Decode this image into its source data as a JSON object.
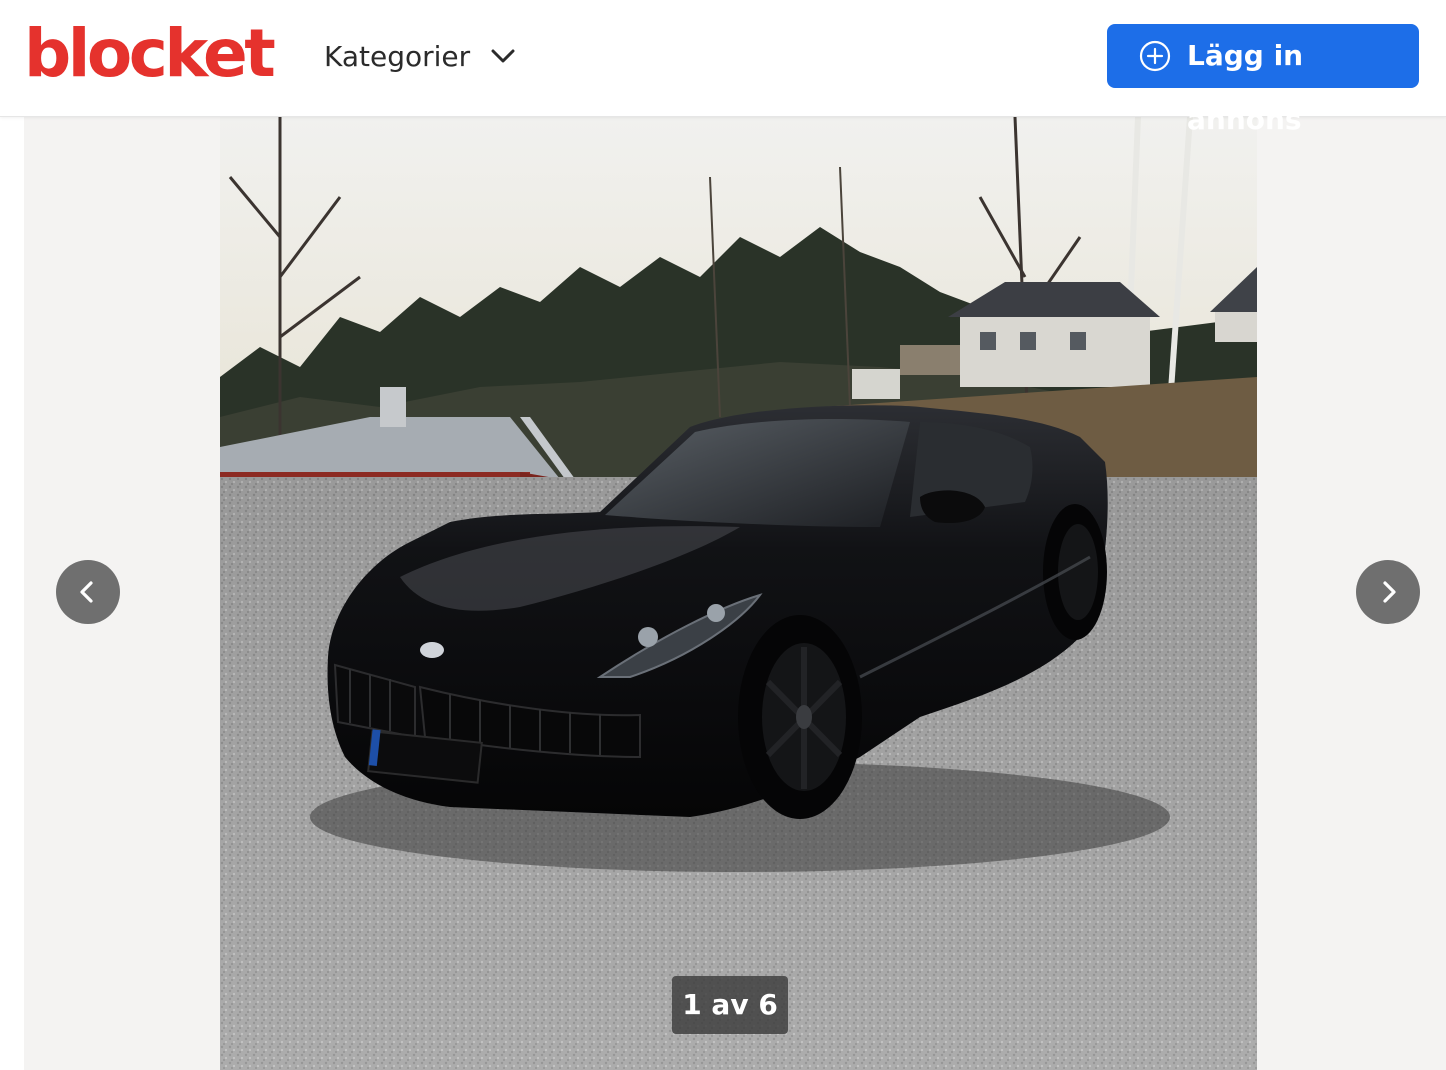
{
  "header": {
    "logo_text": "blocket",
    "categories_label": "Kategorier",
    "cta_label": "Lägg in annons"
  },
  "gallery": {
    "counter_text": "1 av 6",
    "prev_icon": "chevron-left-icon",
    "next_icon": "chevron-right-icon"
  },
  "colors": {
    "brand_red": "#e5322d",
    "cta_blue": "#1d6ee8",
    "gallery_bg": "#f4f3f2",
    "nav_button_bg": "#6f6f6f"
  }
}
